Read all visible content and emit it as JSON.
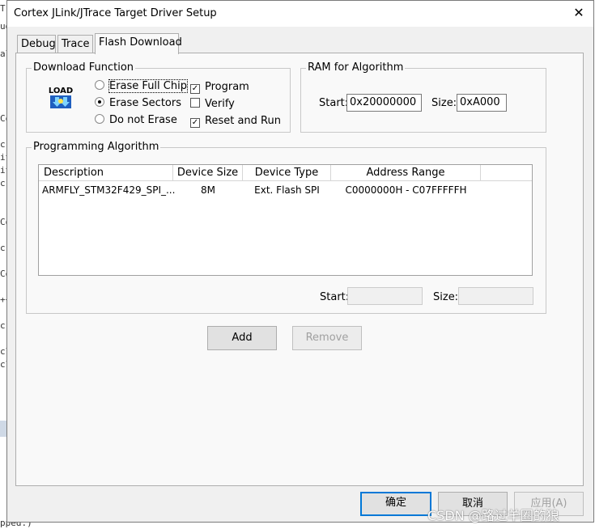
{
  "window": {
    "title": "Cortex JLink/JTrace Target Driver Setup",
    "close_glyph": "✕"
  },
  "tabs": [
    {
      "label": "Debug",
      "active": false
    },
    {
      "label": "Trace",
      "active": false
    },
    {
      "label": "Flash Download",
      "active": true
    }
  ],
  "download_function": {
    "title": "Download Function",
    "icon_text": "LOAD",
    "erase_options": [
      {
        "label": "Erase Full Chip",
        "selected": false
      },
      {
        "label": "Erase Sectors",
        "selected": true
      },
      {
        "label": "Do not Erase",
        "selected": false
      }
    ],
    "checks": [
      {
        "label": "Program",
        "checked": true
      },
      {
        "label": "Verify",
        "checked": false
      },
      {
        "label": "Reset and Run",
        "checked": true
      }
    ]
  },
  "ram_for_algorithm": {
    "title": "RAM for Algorithm",
    "start_label": "Start:",
    "start_value": "0x20000000",
    "size_label": "Size:",
    "size_value": "0xA000"
  },
  "programming_algorithm": {
    "title": "Programming Algorithm",
    "columns": [
      "Description",
      "Device Size",
      "Device Type",
      "Address Range"
    ],
    "rows": [
      {
        "description": "ARMFLY_STM32F429_SPI_...",
        "device_size": "8M",
        "device_type": "Ext. Flash SPI",
        "address_range": "C0000000H - C07FFFFFH"
      }
    ],
    "start_label": "Start:",
    "start_value": "",
    "size_label": "Size:",
    "size_value": ""
  },
  "buttons": {
    "add": "Add",
    "remove": "Remove",
    "ok": "确定",
    "cancel": "取消",
    "apply": "应用(A)"
  },
  "background": {
    "left_fragments": [
      "T",
      "ud",
      "al",
      "Co",
      "cr",
      "it",
      "it",
      "cr",
      "Co",
      "cr",
      "Co",
      "++",
      "cr",
      "cl",
      "cl"
    ],
    "bottom_text": "pped:)"
  },
  "watermark": "CSDN @路过羊圈的狼",
  "colors": {
    "dialog_bg": "#f0f0f0",
    "panel_bg": "#f9f9f9",
    "default_button_border": "#0078d7",
    "disabled_text": "#a0a0a0"
  }
}
